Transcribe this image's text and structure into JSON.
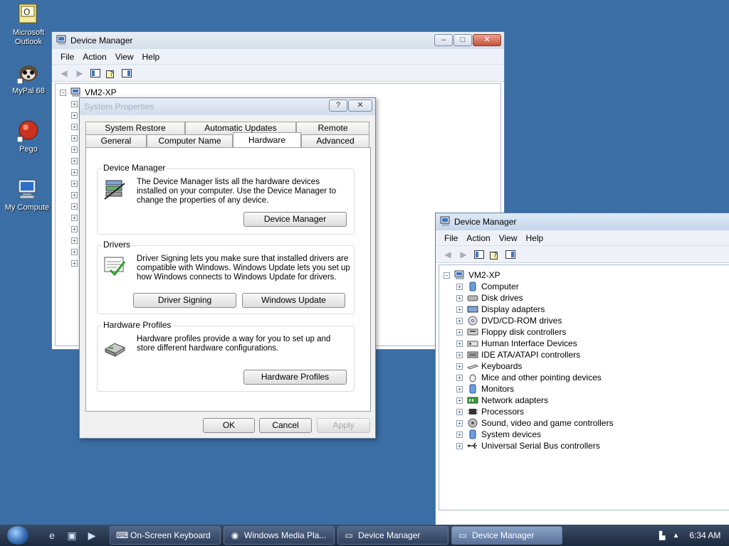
{
  "desktop": {
    "icons": [
      {
        "label": "Microsoft Outlook"
      },
      {
        "label": "MyPal 68"
      },
      {
        "label": "Pego"
      },
      {
        "label": "My Compute"
      }
    ]
  },
  "back_window": {
    "title": "Device Manager",
    "menu": [
      "File",
      "Action",
      "View",
      "Help"
    ],
    "root": "VM2-XP"
  },
  "dialog": {
    "title": "System Properties",
    "tabs_row1": [
      "System Restore",
      "Automatic Updates",
      "Remote"
    ],
    "tabs_row2": [
      "General",
      "Computer Name",
      "Hardware",
      "Advanced"
    ],
    "groups": {
      "device_manager": {
        "title": "Device Manager",
        "text": "The Device Manager lists all the hardware devices installed on your computer. Use the Device Manager to change the properties of any device.",
        "button": "Device Manager"
      },
      "drivers": {
        "title": "Drivers",
        "text": "Driver Signing lets you make sure that installed drivers are compatible with Windows. Windows Update lets you set up how Windows connects to Windows Update for drivers.",
        "button1": "Driver Signing",
        "button2": "Windows Update"
      },
      "hardware_profiles": {
        "title": "Hardware Profiles",
        "text": "Hardware profiles provide a way for you to set up and store different hardware configurations.",
        "button": "Hardware Profiles"
      }
    },
    "ok": "OK",
    "cancel": "Cancel",
    "apply": "Apply"
  },
  "front_window": {
    "title": "Device Manager",
    "menu": [
      "File",
      "Action",
      "View",
      "Help"
    ],
    "root": "VM2-XP",
    "nodes": [
      {
        "label": "Computer",
        "icon": "computer-icon"
      },
      {
        "label": "Disk drives",
        "icon": "disk-drive-icon"
      },
      {
        "label": "Display adapters",
        "icon": "display-adapter-icon"
      },
      {
        "label": "DVD/CD-ROM drives",
        "icon": "dvd-drive-icon"
      },
      {
        "label": "Floppy disk controllers",
        "icon": "floppy-controller-icon"
      },
      {
        "label": "Human Interface Devices",
        "icon": "hid-icon"
      },
      {
        "label": "IDE ATA/ATAPI controllers",
        "icon": "ide-controller-icon"
      },
      {
        "label": "Keyboards",
        "icon": "keyboard-icon"
      },
      {
        "label": "Mice and other pointing devices",
        "icon": "mouse-icon"
      },
      {
        "label": "Monitors",
        "icon": "monitor-icon"
      },
      {
        "label": "Network adapters",
        "icon": "network-adapter-icon"
      },
      {
        "label": "Processors",
        "icon": "processor-icon"
      },
      {
        "label": "Sound, video and game controllers",
        "icon": "sound-icon"
      },
      {
        "label": "System devices",
        "icon": "system-device-icon"
      },
      {
        "label": "Universal Serial Bus controllers",
        "icon": "usb-icon"
      }
    ]
  },
  "taskbar": {
    "tasks": [
      {
        "label": "On-Screen Keyboard"
      },
      {
        "label": "Windows Media Pla..."
      },
      {
        "label": "Device Manager"
      },
      {
        "label": "Device Manager"
      }
    ],
    "clock": "6:34 AM"
  }
}
